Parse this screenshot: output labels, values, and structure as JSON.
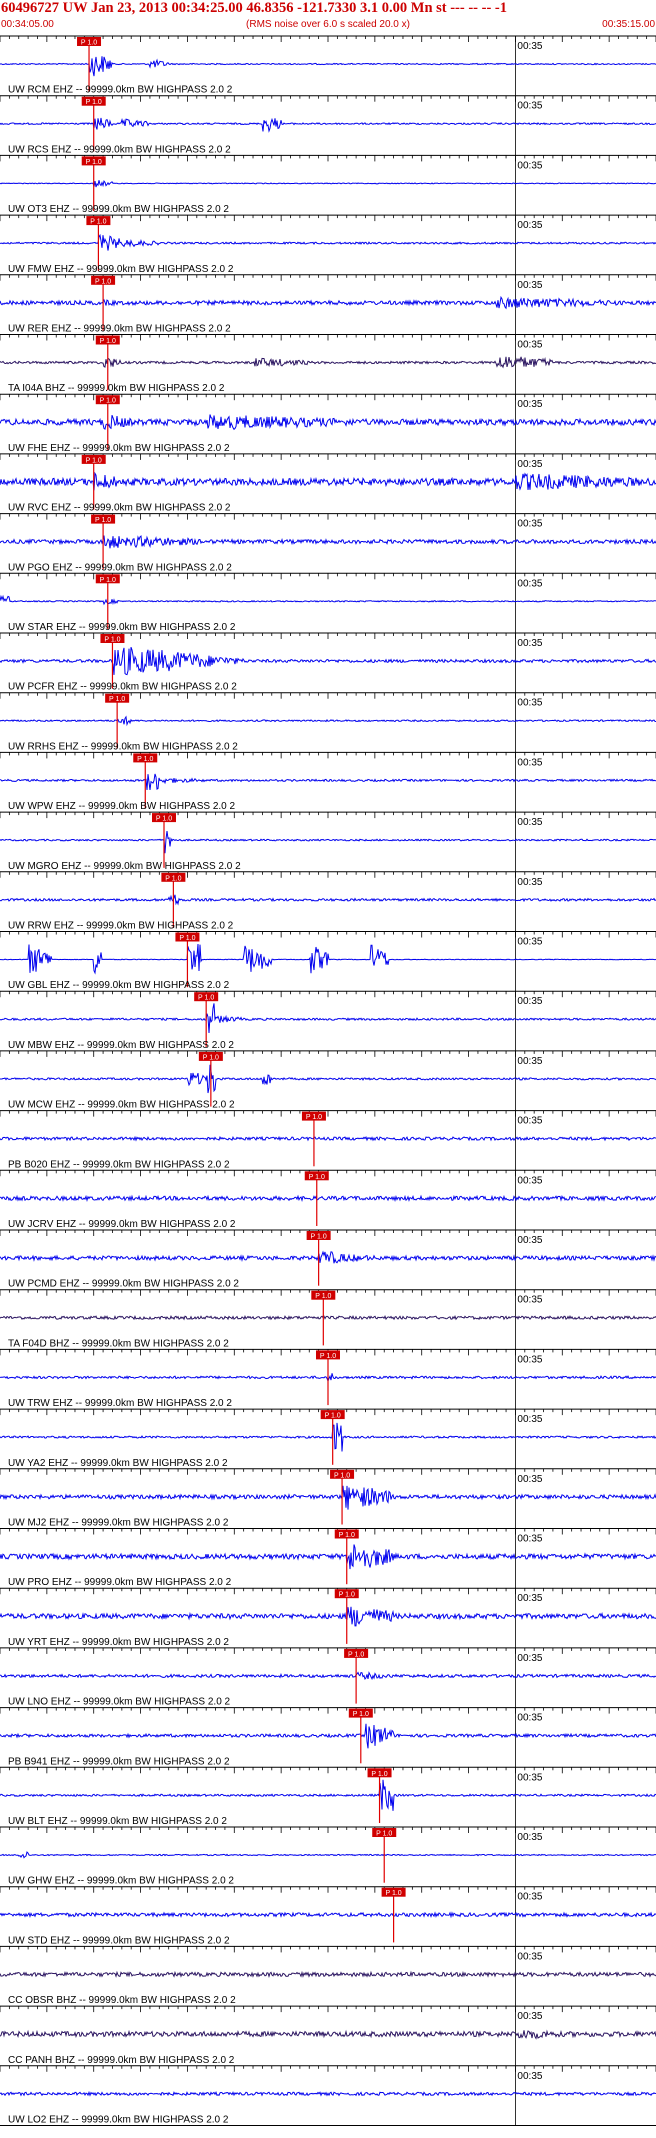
{
  "header": {
    "title": "60496727 UW Jan 23, 2013 00:34:25.00   46.8356 -121.7330  3.1 0.00 Mn st --- -- --   -1",
    "start_time": "00:34:05.00",
    "end_time": "00:35:15.00",
    "note": "(RMS noise over 6.0 s scaled 20.0 x)"
  },
  "chart_data": {
    "type": "line",
    "title": "60496727 UW Jan 23, 2013 00:34:25.00   46.8356 -121.7330  3.1 0.00 Mn st --- -- --   -1",
    "x_range": [
      "00:34:05.00",
      "00:35:15.00"
    ],
    "x_range_seconds": [
      0,
      70
    ],
    "minute_tick": {
      "label": "00:35",
      "t_seconds": 55
    },
    "pick_label": "P 1.0",
    "colors": {
      "trace": "#0000ee",
      "dark_trace": "#2a1460",
      "pick": "#e00000",
      "label_bg": "#d00000",
      "text": "#000000",
      "grid": "#000000"
    },
    "traces": [
      {
        "label": "UW RCM EHZ -- 99999.0km BW  HIGHPASS  2.0  2",
        "pick_t": 9.5,
        "color": "blue",
        "signal": [
          [
            9.5,
            12,
            14
          ],
          [
            16,
            18,
            5
          ]
        ],
        "noise": 0.6
      },
      {
        "label": "UW RCS EHZ -- 99999.0km BW  HIGHPASS  2.0  2",
        "pick_t": 10.0,
        "color": "blue",
        "signal": [
          [
            10,
            12,
            8
          ],
          [
            13,
            16,
            5
          ],
          [
            28,
            30,
            10
          ]
        ],
        "noise": 0.8
      },
      {
        "label": "UW OT3 EHZ -- 99999.0km BW  HIGHPASS  2.0  2",
        "pick_t": 10.0,
        "color": "blue",
        "signal": [
          [
            10,
            12,
            4
          ]
        ],
        "noise": 0.4
      },
      {
        "label": "UW FMW EHZ -- 99999.0km BW  HIGHPASS  2.0  2",
        "pick_t": 10.5,
        "color": "blue",
        "signal": [
          [
            10.5,
            13,
            10
          ],
          [
            13,
            17,
            4
          ]
        ],
        "noise": 0.9
      },
      {
        "label": "UW RER EHZ -- 99999.0km BW  HIGHPASS  2.0  2",
        "pick_t": 11.0,
        "color": "blue",
        "signal": [
          [
            11,
            14,
            3
          ],
          [
            53,
            66,
            6
          ]
        ],
        "noise": 2.0
      },
      {
        "label": "TA I04A BHZ -- 99999.0km BW  HIGHPASS  2.0  2",
        "pick_t": 11.5,
        "color": "dark",
        "signal": [
          [
            11,
            13,
            7
          ],
          [
            27,
            33,
            5
          ],
          [
            53,
            59,
            8
          ]
        ],
        "noise": 1.2
      },
      {
        "label": "UW FHE EHZ -- 99999.0km BW  HIGHPASS  2.0  2",
        "pick_t": 11.5,
        "color": "blue",
        "signal": [
          [
            11,
            14,
            9
          ],
          [
            22,
            38,
            8
          ]
        ],
        "noise": 3.0
      },
      {
        "label": "UW RVC EHZ -- 99999.0km BW  HIGHPASS  2.0  2",
        "pick_t": 10.0,
        "color": "blue",
        "signal": [
          [
            10,
            13,
            10
          ],
          [
            55,
            70,
            9
          ]
        ],
        "noise": 3.5
      },
      {
        "label": "UW PGO EHZ -- 99999.0km BW  HIGHPASS  2.0  2",
        "pick_t": 11.0,
        "color": "blue",
        "signal": [
          [
            11,
            14,
            9
          ],
          [
            14,
            22,
            6
          ]
        ],
        "noise": 2.0
      },
      {
        "label": "UW STAR EHZ -- 99999.0km BW  HIGHPASS  2.0  2",
        "pick_t": 11.5,
        "color": "blue",
        "signal": [
          [
            0,
            1,
            5
          ],
          [
            11,
            13,
            3
          ]
        ],
        "noise": 0.6
      },
      {
        "label": "UW PCFR EHZ -- 99999.0km BW  HIGHPASS  2.0  2",
        "pick_t": 12.0,
        "color": "blue",
        "signal": [
          [
            12,
            22,
            16
          ],
          [
            22,
            26,
            6
          ]
        ],
        "noise": 1.5
      },
      {
        "label": "UW RRHS EHZ -- 99999.0km BW  HIGHPASS  2.0  2",
        "pick_t": 12.5,
        "color": "blue",
        "signal": [
          [
            12.5,
            14,
            4
          ]
        ],
        "noise": 0.8
      },
      {
        "label": "UW WPW EHZ -- 99999.0km BW  HIGHPASS  2.0  2",
        "pick_t": 15.5,
        "color": "blue",
        "signal": [
          [
            15.5,
            17,
            10
          ],
          [
            17,
            22,
            3
          ]
        ],
        "noise": 1.0
      },
      {
        "label": "UW MGRO EHZ -- 99999.0km BW  HIGHPASS  2.0  2",
        "pick_t": 17.5,
        "color": "blue",
        "signal": [
          [
            17.5,
            18.5,
            14
          ]
        ],
        "noise": 0.8
      },
      {
        "label": "UW RRW EHZ -- 99999.0km BW  HIGHPASS  2.0  2",
        "pick_t": 18.5,
        "color": "blue",
        "signal": [
          [
            18,
            19,
            6
          ]
        ],
        "noise": 1.2
      },
      {
        "label": "UW GBL EHZ -- 99999.0km BW  HIGHPASS  2.0  2",
        "pick_t": 20.0,
        "color": "blue",
        "signal": [
          [
            3,
            5.5,
            16
          ],
          [
            10,
            10.8,
            16
          ],
          [
            20,
            21.5,
            16
          ],
          [
            26,
            29,
            16
          ],
          [
            33,
            35,
            16
          ],
          [
            39.5,
            41.5,
            16
          ]
        ],
        "noise": 0.3
      },
      {
        "label": "UW MBW EHZ -- 99999.0km BW  HIGHPASS  2.0  2",
        "pick_t": 22.0,
        "color": "blue",
        "signal": [
          [
            22,
            23,
            16
          ],
          [
            23,
            26,
            4
          ]
        ],
        "noise": 1.0
      },
      {
        "label": "UW MCW EHZ -- 99999.0km BW  HIGHPASS  2.0  2",
        "pick_t": 22.5,
        "color": "blue",
        "signal": [
          [
            20,
            22,
            9
          ],
          [
            22,
            23,
            16
          ],
          [
            28,
            29,
            8
          ]
        ],
        "noise": 1.0
      },
      {
        "label": "PB B020 EHZ -- 99999.0km BW  HIGHPASS  2.0  2",
        "pick_t": 33.5,
        "color": "blue",
        "signal": [],
        "noise": 1.5
      },
      {
        "label": "UW JCRV EHZ -- 99999.0km BW  HIGHPASS  2.0  2",
        "pick_t": 33.8,
        "color": "blue",
        "signal": [],
        "noise": 2.0
      },
      {
        "label": "UW PCMD EHZ -- 99999.0km BW  HIGHPASS  2.0  2",
        "pick_t": 34.0,
        "color": "blue",
        "signal": [
          [
            34,
            37,
            9
          ],
          [
            37,
            41,
            4
          ]
        ],
        "noise": 2.0
      },
      {
        "label": "TA F04D BHZ -- 99999.0km BW  HIGHPASS  2.0  2",
        "pick_t": 34.5,
        "color": "dark",
        "signal": [],
        "noise": 1.5
      },
      {
        "label": "UW TRW EHZ -- 99999.0km BW  HIGHPASS  2.0  2",
        "pick_t": 35.0,
        "color": "blue",
        "signal": [
          [
            35,
            35.5,
            6
          ]
        ],
        "noise": 1.2
      },
      {
        "label": "UW YA2 EHZ -- 99999.0km BW  HIGHPASS  2.0  2",
        "pick_t": 35.5,
        "color": "blue",
        "signal": [
          [
            35.5,
            36.5,
            16
          ]
        ],
        "noise": 1.0
      },
      {
        "label": "UW MJ2 EHZ -- 99999.0km BW  HIGHPASS  2.0  2",
        "pick_t": 36.5,
        "color": "blue",
        "signal": [
          [
            36.5,
            42,
            14
          ]
        ],
        "noise": 2.0
      },
      {
        "label": "UW PRO EHZ -- 99999.0km BW  HIGHPASS  2.0  2",
        "pick_t": 37.0,
        "color": "blue",
        "signal": [
          [
            37,
            42,
            16
          ]
        ],
        "noise": 2.5
      },
      {
        "label": "UW YRT EHZ -- 99999.0km BW  HIGHPASS  2.0  2",
        "pick_t": 37.0,
        "color": "blue",
        "signal": [
          [
            37,
            42,
            12
          ]
        ],
        "noise": 2.5
      },
      {
        "label": "UW LNO EHZ -- 99999.0km BW  HIGHPASS  2.0  2",
        "pick_t": 38.0,
        "color": "blue",
        "signal": [
          [
            38,
            42,
            4
          ]
        ],
        "noise": 1.5
      },
      {
        "label": "PB B941 EHZ -- 99999.0km BW  HIGHPASS  2.0  2",
        "pick_t": 38.5,
        "color": "blue",
        "signal": [
          [
            39,
            42,
            14
          ]
        ],
        "noise": 1.5
      },
      {
        "label": "UW BLT EHZ -- 99999.0km BW  HIGHPASS  2.0  2",
        "pick_t": 40.5,
        "color": "blue",
        "signal": [
          [
            40.5,
            42,
            16
          ]
        ],
        "noise": 1.0
      },
      {
        "label": "UW GHW EHZ -- 99999.0km BW  HIGHPASS  2.0  2",
        "pick_t": 41.0,
        "color": "blue",
        "signal": [
          [
            2,
            3,
            4
          ]
        ],
        "noise": 0.6
      },
      {
        "label": "UW STD EHZ -- 99999.0km BW  HIGHPASS  2.0  2",
        "pick_t": 42.0,
        "color": "blue",
        "signal": [],
        "noise": 1.8
      },
      {
        "label": "CC OBSR BHZ -- 99999.0km BW  HIGHPASS  2.0  2",
        "pick_t": null,
        "color": "dark",
        "signal": [],
        "noise": 2.0
      },
      {
        "label": "CC PANH BHZ -- 99999.0km BW  HIGHPASS  2.0  2",
        "pick_t": null,
        "color": "dark",
        "signal": [
          [
            55,
            60,
            6
          ]
        ],
        "noise": 2.5
      },
      {
        "label": "UW LO2 EHZ -- 99999.0km BW  HIGHPASS  2.0  2",
        "pick_t": null,
        "color": "blue",
        "signal": [],
        "noise": 1.5
      }
    ]
  }
}
